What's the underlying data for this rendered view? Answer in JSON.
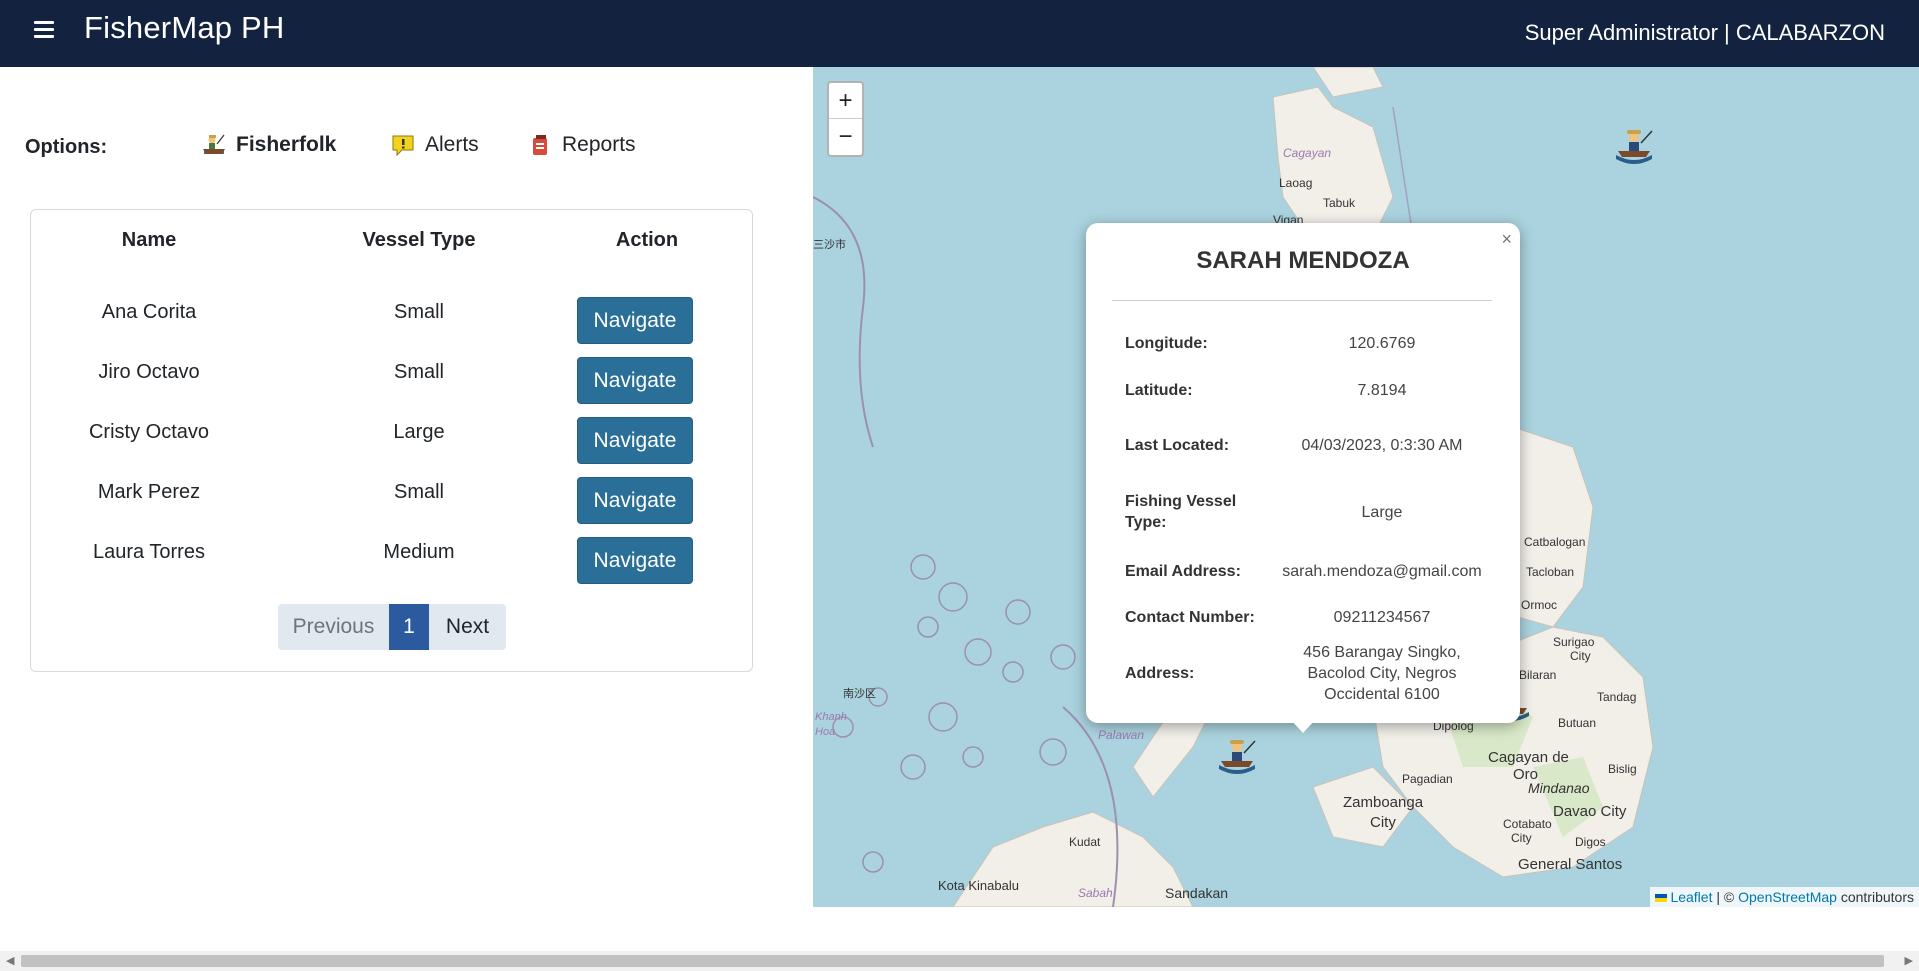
{
  "header": {
    "app_title": "FisherMap PH",
    "user_info": "Super Administrator | CALABARZON"
  },
  "options": {
    "label": "Options:",
    "items": [
      {
        "label": "Fisherfolk",
        "icon": "fisherman-icon",
        "active": true
      },
      {
        "label": "Alerts",
        "icon": "alert-icon",
        "active": false
      },
      {
        "label": "Reports",
        "icon": "report-icon",
        "active": false
      }
    ]
  },
  "table": {
    "headers": [
      "Name",
      "Vessel Type",
      "Action"
    ],
    "rows": [
      {
        "name": "Ana Corita",
        "vessel": "Small",
        "action": "Navigate"
      },
      {
        "name": "Jiro Octavo",
        "vessel": "Small",
        "action": "Navigate"
      },
      {
        "name": "Cristy Octavo",
        "vessel": "Large",
        "action": "Navigate"
      },
      {
        "name": "Mark Perez",
        "vessel": "Small",
        "action": "Navigate"
      },
      {
        "name": "Laura Torres",
        "vessel": "Medium",
        "action": "Navigate"
      }
    ],
    "pagination": {
      "previous": "Previous",
      "current": "1",
      "next": "Next"
    }
  },
  "map": {
    "zoom_in": "+",
    "zoom_out": "−",
    "attribution": {
      "leaflet": "Leaflet",
      "sep": " | © ",
      "osm": "OpenStreetMap",
      "suffix": " contributors"
    },
    "labels": [
      "Cagayan",
      "Laoag",
      "Tabuk",
      "Vigan",
      "三沙市",
      "南沙区",
      "Khanh Hoa",
      "Palawan",
      "Kudat",
      "Kota Kinabalu",
      "Sabah",
      "Sandakan",
      "Zamboanga City",
      "Pagadian",
      "Dipolog",
      "Cagayan de Oro",
      "Mindanao",
      "Davao City",
      "Cotabato City",
      "Digos",
      "General Santos",
      "Butuan",
      "Surigao City",
      "Tandag",
      "Bislig",
      "Catbalogan",
      "Tacloban",
      "Ormoc",
      "Bilaran"
    ]
  },
  "popup": {
    "close": "×",
    "title": "SARAH MENDOZA",
    "fields": [
      {
        "label": "Longitude:",
        "value": "120.6769"
      },
      {
        "label": "Latitude:",
        "value": "7.8194"
      },
      {
        "label": "Last Located:",
        "value": "04/03/2023, 0:3:30 AM"
      },
      {
        "label": "Fishing Vessel Type:",
        "value": "Large"
      },
      {
        "label": "Email Address:",
        "value": "sarah.mendoza@gmail.com"
      },
      {
        "label": "Contact Number:",
        "value": "09211234567"
      },
      {
        "label": "Address:",
        "value": "456 Barangay Singko, Bacolod City, Negros Occidental 6100"
      }
    ]
  },
  "colors": {
    "header_bg": "#13233f",
    "button": "#2a6f97",
    "water": "#aad3df",
    "land": "#f2efe9"
  }
}
